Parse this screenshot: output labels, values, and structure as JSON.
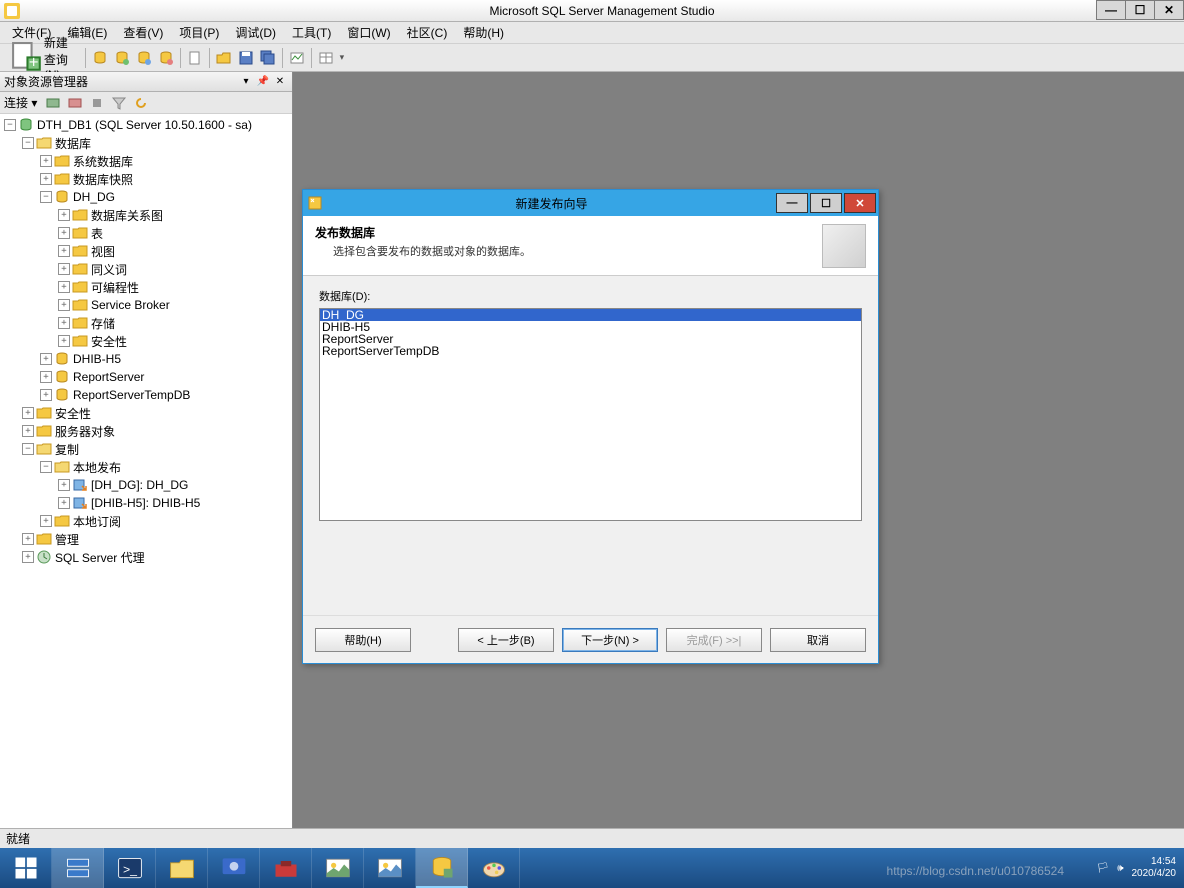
{
  "app": {
    "title": "Microsoft SQL Server Management Studio"
  },
  "menu": {
    "file": "文件(F)",
    "edit": "编辑(E)",
    "view": "查看(V)",
    "project": "项目(P)",
    "debug": "调试(D)",
    "tools": "工具(T)",
    "window": "窗口(W)",
    "community": "社区(C)",
    "help": "帮助(H)"
  },
  "toolbar": {
    "new_query": "新建查询(N)"
  },
  "sidebar": {
    "title": "对象资源管理器",
    "connect_label": "连接 ▾",
    "root": "DTH_DB1 (SQL Server 10.50.1600 - sa)",
    "databases": "数据库",
    "system_db": "系统数据库",
    "db_snapshot": "数据库快照",
    "dh_dg": "DH_DG",
    "db_diagram": "数据库关系图",
    "tables": "表",
    "views": "视图",
    "synonyms": "同义词",
    "programmability": "可编程性",
    "service_broker": "Service Broker",
    "storage": "存储",
    "security_node": "安全性",
    "dhib_h5": "DHIB-H5",
    "report_server": "ReportServer",
    "report_server_temp": "ReportServerTempDB",
    "security": "安全性",
    "server_objects": "服务器对象",
    "replication": "复制",
    "local_pub": "本地发布",
    "pub_dhdg": "[DH_DG]: DH_DG",
    "pub_dhib": "[DHIB-H5]: DHIB-H5",
    "local_sub": "本地订阅",
    "management": "管理",
    "sql_agent": "SQL Server 代理"
  },
  "dialog": {
    "title": "新建发布向导",
    "header_title": "发布数据库",
    "header_sub": "选择包含要发布的数据或对象的数据库。",
    "list_label": "数据库(D):",
    "items": [
      "DH_DG",
      "DHIB-H5",
      "ReportServer",
      "ReportServerTempDB"
    ],
    "selected_index": 0,
    "btn_help": "帮助(H)",
    "btn_back": "< 上一步(B)",
    "btn_next": "下一步(N) >",
    "btn_finish": "完成(F) >>|",
    "btn_cancel": "取消"
  },
  "status": {
    "text": "就绪"
  },
  "tray": {
    "time": "14:54",
    "date": "2020/4/20"
  },
  "watermark": "https://blog.csdn.net/u010786524"
}
